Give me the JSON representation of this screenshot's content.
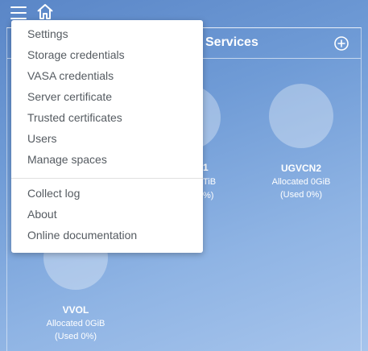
{
  "topbar": {
    "menu_icon": "hamburger-icon",
    "home_icon": "home-icon"
  },
  "panel": {
    "title": "Services",
    "add_icon": "plus-circle-icon"
  },
  "services": {
    "partial": {
      "name_fragment": "1",
      "allocated_fragment": "TiB",
      "used_fragment": "%)"
    },
    "ugvcn2": {
      "name": "UGVCN2",
      "allocated": "Allocated 0GiB",
      "used": "(Used 0%)"
    },
    "vvol": {
      "name": "VVOL",
      "allocated": "Allocated 0GiB",
      "used": "(Used 0%)"
    }
  },
  "menu": {
    "items": [
      "Settings",
      "Storage credentials",
      "VASA credentials",
      "Server certificate",
      "Trusted certificates",
      "Users",
      "Manage spaces"
    ],
    "items_secondary": [
      "Collect log",
      "About",
      "Online documentation"
    ]
  },
  "colors": {
    "background_top": "#5a86c7",
    "background_bottom": "#a6c4ec",
    "menu_text": "#555b61",
    "menu_bg": "#ffffff"
  }
}
